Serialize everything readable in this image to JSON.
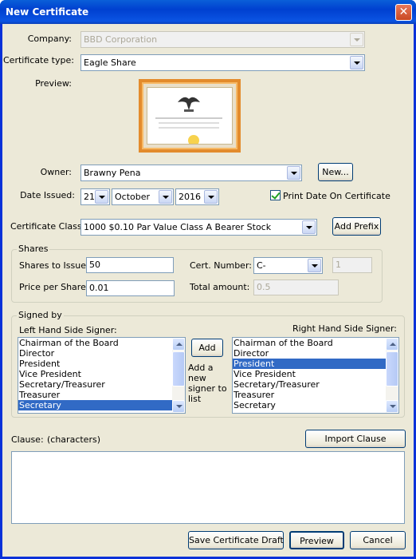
{
  "window": {
    "title": "New Certificate",
    "close_glyph": "✕"
  },
  "form": {
    "company_label": "Company:",
    "company_value": "BBD Corporation",
    "cert_type_label": "Certificate type:",
    "cert_type_value": "Eagle Share",
    "preview_label": "Preview:",
    "owner_label": "Owner:",
    "owner_value": "Brawny Pena",
    "new_button": "New...",
    "date_issued_label": "Date Issued:",
    "date_day": "21",
    "date_month": "October",
    "date_year": "2016",
    "print_date_label": "Print Date On Certificate",
    "print_date_checked": true,
    "cert_class_label": "Certificate Class:",
    "cert_class_value": "1000 $0.10 Par Value Class A Bearer Stock",
    "add_prefix_button": "Add Prefix"
  },
  "shares": {
    "legend": "Shares",
    "shares_to_issue_label": "Shares to Issue:",
    "shares_to_issue_value": "50",
    "price_per_share_label": "Price per Share:",
    "price_per_share_value": "0.01",
    "cert_number_label": "Cert. Number:",
    "cert_number_prefix": "C-",
    "cert_number_value": "1",
    "total_amount_label": "Total amount:",
    "total_amount_value": "0.5"
  },
  "signed_by": {
    "legend": "Signed by",
    "left_label": "Left Hand Side Signer:",
    "right_label": "Right Hand Side Signer:",
    "add_button": "Add",
    "add_hint": "Add a new signer to list",
    "left_items": [
      "Chairman of the Board",
      "Director",
      "President",
      "Vice President",
      "Secretary/Treasurer",
      "Treasurer",
      "Secretary"
    ],
    "left_selected": "Secretary",
    "right_items": [
      "Chairman of the Board",
      "Director",
      "President",
      "Vice President",
      "Secretary/Treasurer",
      "Treasurer",
      "Secretary"
    ],
    "right_selected": "President"
  },
  "clause": {
    "label": "Clause:",
    "characters": "(characters)",
    "import_button": "Import Clause",
    "value": ""
  },
  "footer": {
    "save_draft_button": "Save Certificate Draft",
    "preview_button": "Preview",
    "cancel_button": "Cancel"
  },
  "colors": {
    "titlebar": "#0a5fd8",
    "selection": "#316ac5",
    "window_bg": "#ece9d8"
  }
}
